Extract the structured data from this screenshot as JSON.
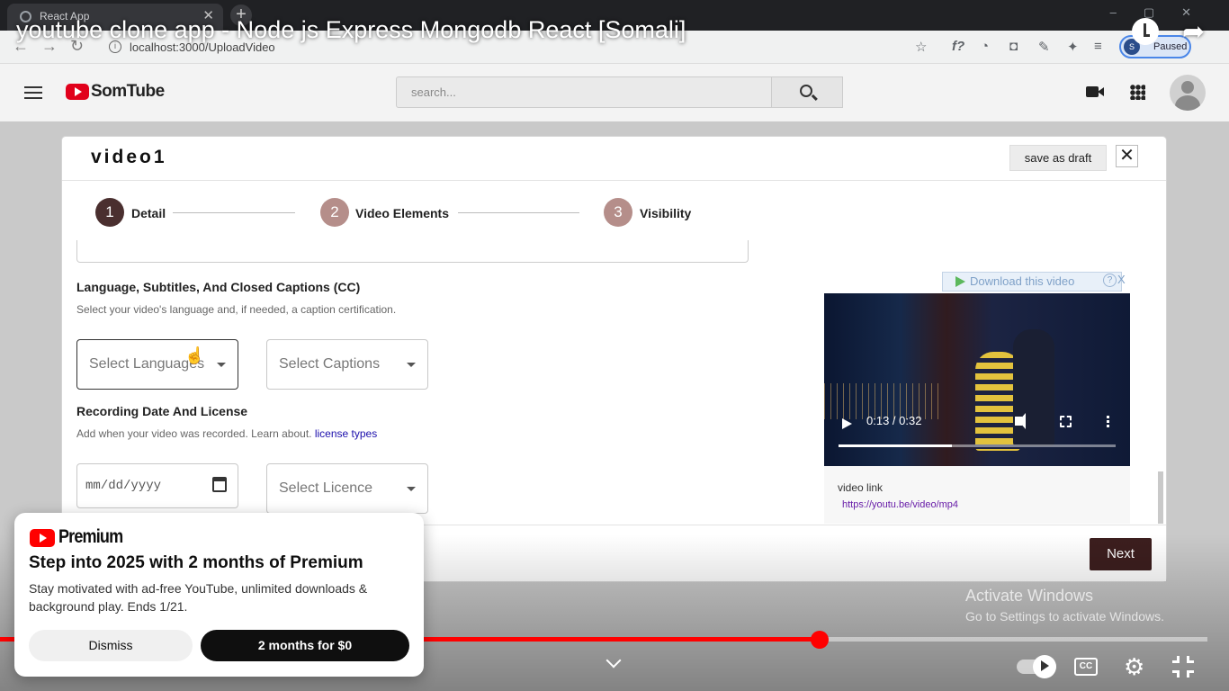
{
  "browser": {
    "tab_title": "React App",
    "url": "localhost:3000/UploadVideo",
    "profile_badge": "Paused",
    "profile_initial": "S"
  },
  "player": {
    "title": "youtube clone app - Node js Express Mongodb React [Somali]",
    "progress_fraction": 0.675,
    "watermark_line1": "Activate Windows",
    "watermark_line2": "Go to Settings to activate Windows."
  },
  "app": {
    "brand": "SomTube",
    "search_placeholder": "search..."
  },
  "dialog": {
    "title": "video1",
    "save_draft": "save as draft",
    "close": "✕",
    "steps": [
      {
        "num": "1",
        "label": "Detail",
        "color": "#4a2f2f"
      },
      {
        "num": "2",
        "label": "Video Elements",
        "color": "#b58e8a"
      },
      {
        "num": "3",
        "label": "Visibility",
        "color": "#b58e8a"
      }
    ],
    "language_section": {
      "title": "Language, Subtitles, And Closed Captions (CC)",
      "desc": "Select your video's language and, if needed, a caption certification.",
      "language_select": "Select Languages",
      "captions_select": "Select Captions"
    },
    "recording_section": {
      "title": "Recording Date And License",
      "desc": "Add when your video was recorded. Learn about.",
      "link": "license types",
      "date_placeholder": "mm/dd/yyyy",
      "licence_select": "Select Licence"
    },
    "preview": {
      "download_label": "Download this video",
      "download_help": "?",
      "download_close": "X",
      "time": "0:13 / 0:32",
      "progress_fraction": 0.41,
      "link_label": "video link",
      "link_url": "https://youtu.be/video/mp4"
    },
    "next": "Next"
  },
  "premium": {
    "brand": "Premium",
    "headline": "Step into 2025 with 2 months of Premium",
    "body": "Stay motivated with ad-free YouTube, unlimited downloads & background play. Ends 1/21.",
    "dismiss": "Dismiss",
    "offer": "2 months for $0"
  }
}
